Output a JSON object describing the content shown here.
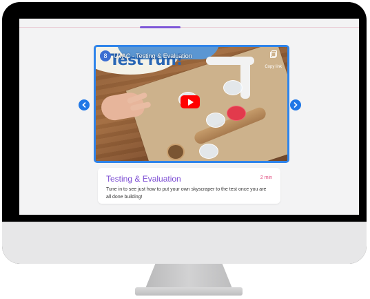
{
  "video": {
    "channel_avatar_text": "8",
    "title": "UVAC - Testing & Evaluation",
    "thumbnail_text": "Test run!",
    "copy_link_label": "Copy link"
  },
  "card": {
    "title": "Testing & Evaluation",
    "duration": "2 min",
    "description": "Tune in to see just how to put your own skyscraper to the test once you are all done building!"
  },
  "colors": {
    "accent_blue": "#1f77e6",
    "title_purple": "#7c4dd3",
    "duration_pink": "#e0457b",
    "play_red": "#ff0000"
  }
}
